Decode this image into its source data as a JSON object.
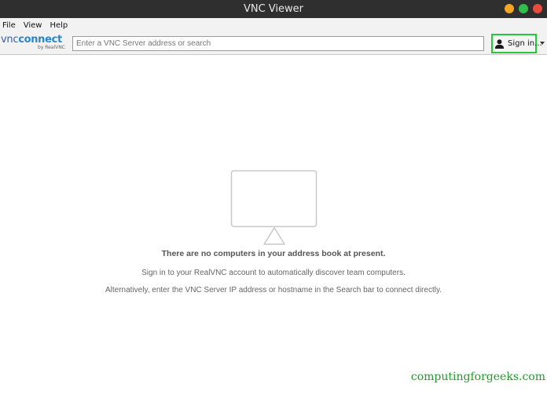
{
  "window": {
    "title": "VNC Viewer"
  },
  "menu": {
    "items": [
      "File",
      "View",
      "Help"
    ]
  },
  "logo": {
    "brand_vnc": "vnc",
    "brand_connect": "connect",
    "by": "by RealVNC"
  },
  "search": {
    "placeholder": "Enter a VNC Server address or search",
    "value": ""
  },
  "account": {
    "signin_label": "Sign in..."
  },
  "empty_state": {
    "title": "There are no computers in your address book at present.",
    "line1": "Sign in to your RealVNC account to automatically discover team computers.",
    "line2": "Alternatively, enter the VNC Server IP address or hostname in the Search bar to connect directly."
  },
  "watermark": "computingforgeeks.com",
  "colors": {
    "titlebar": "#2f2f2f",
    "signin_highlight": "#22c93a",
    "minimize": "#f5a623",
    "maximize": "#2fbf4a",
    "close": "#e84c3d",
    "watermark": "#1f9a2e"
  },
  "icons": [
    "minimize-icon",
    "maximize-icon",
    "close-icon",
    "user-icon",
    "dropdown-arrow-icon",
    "monitor-icon"
  ]
}
